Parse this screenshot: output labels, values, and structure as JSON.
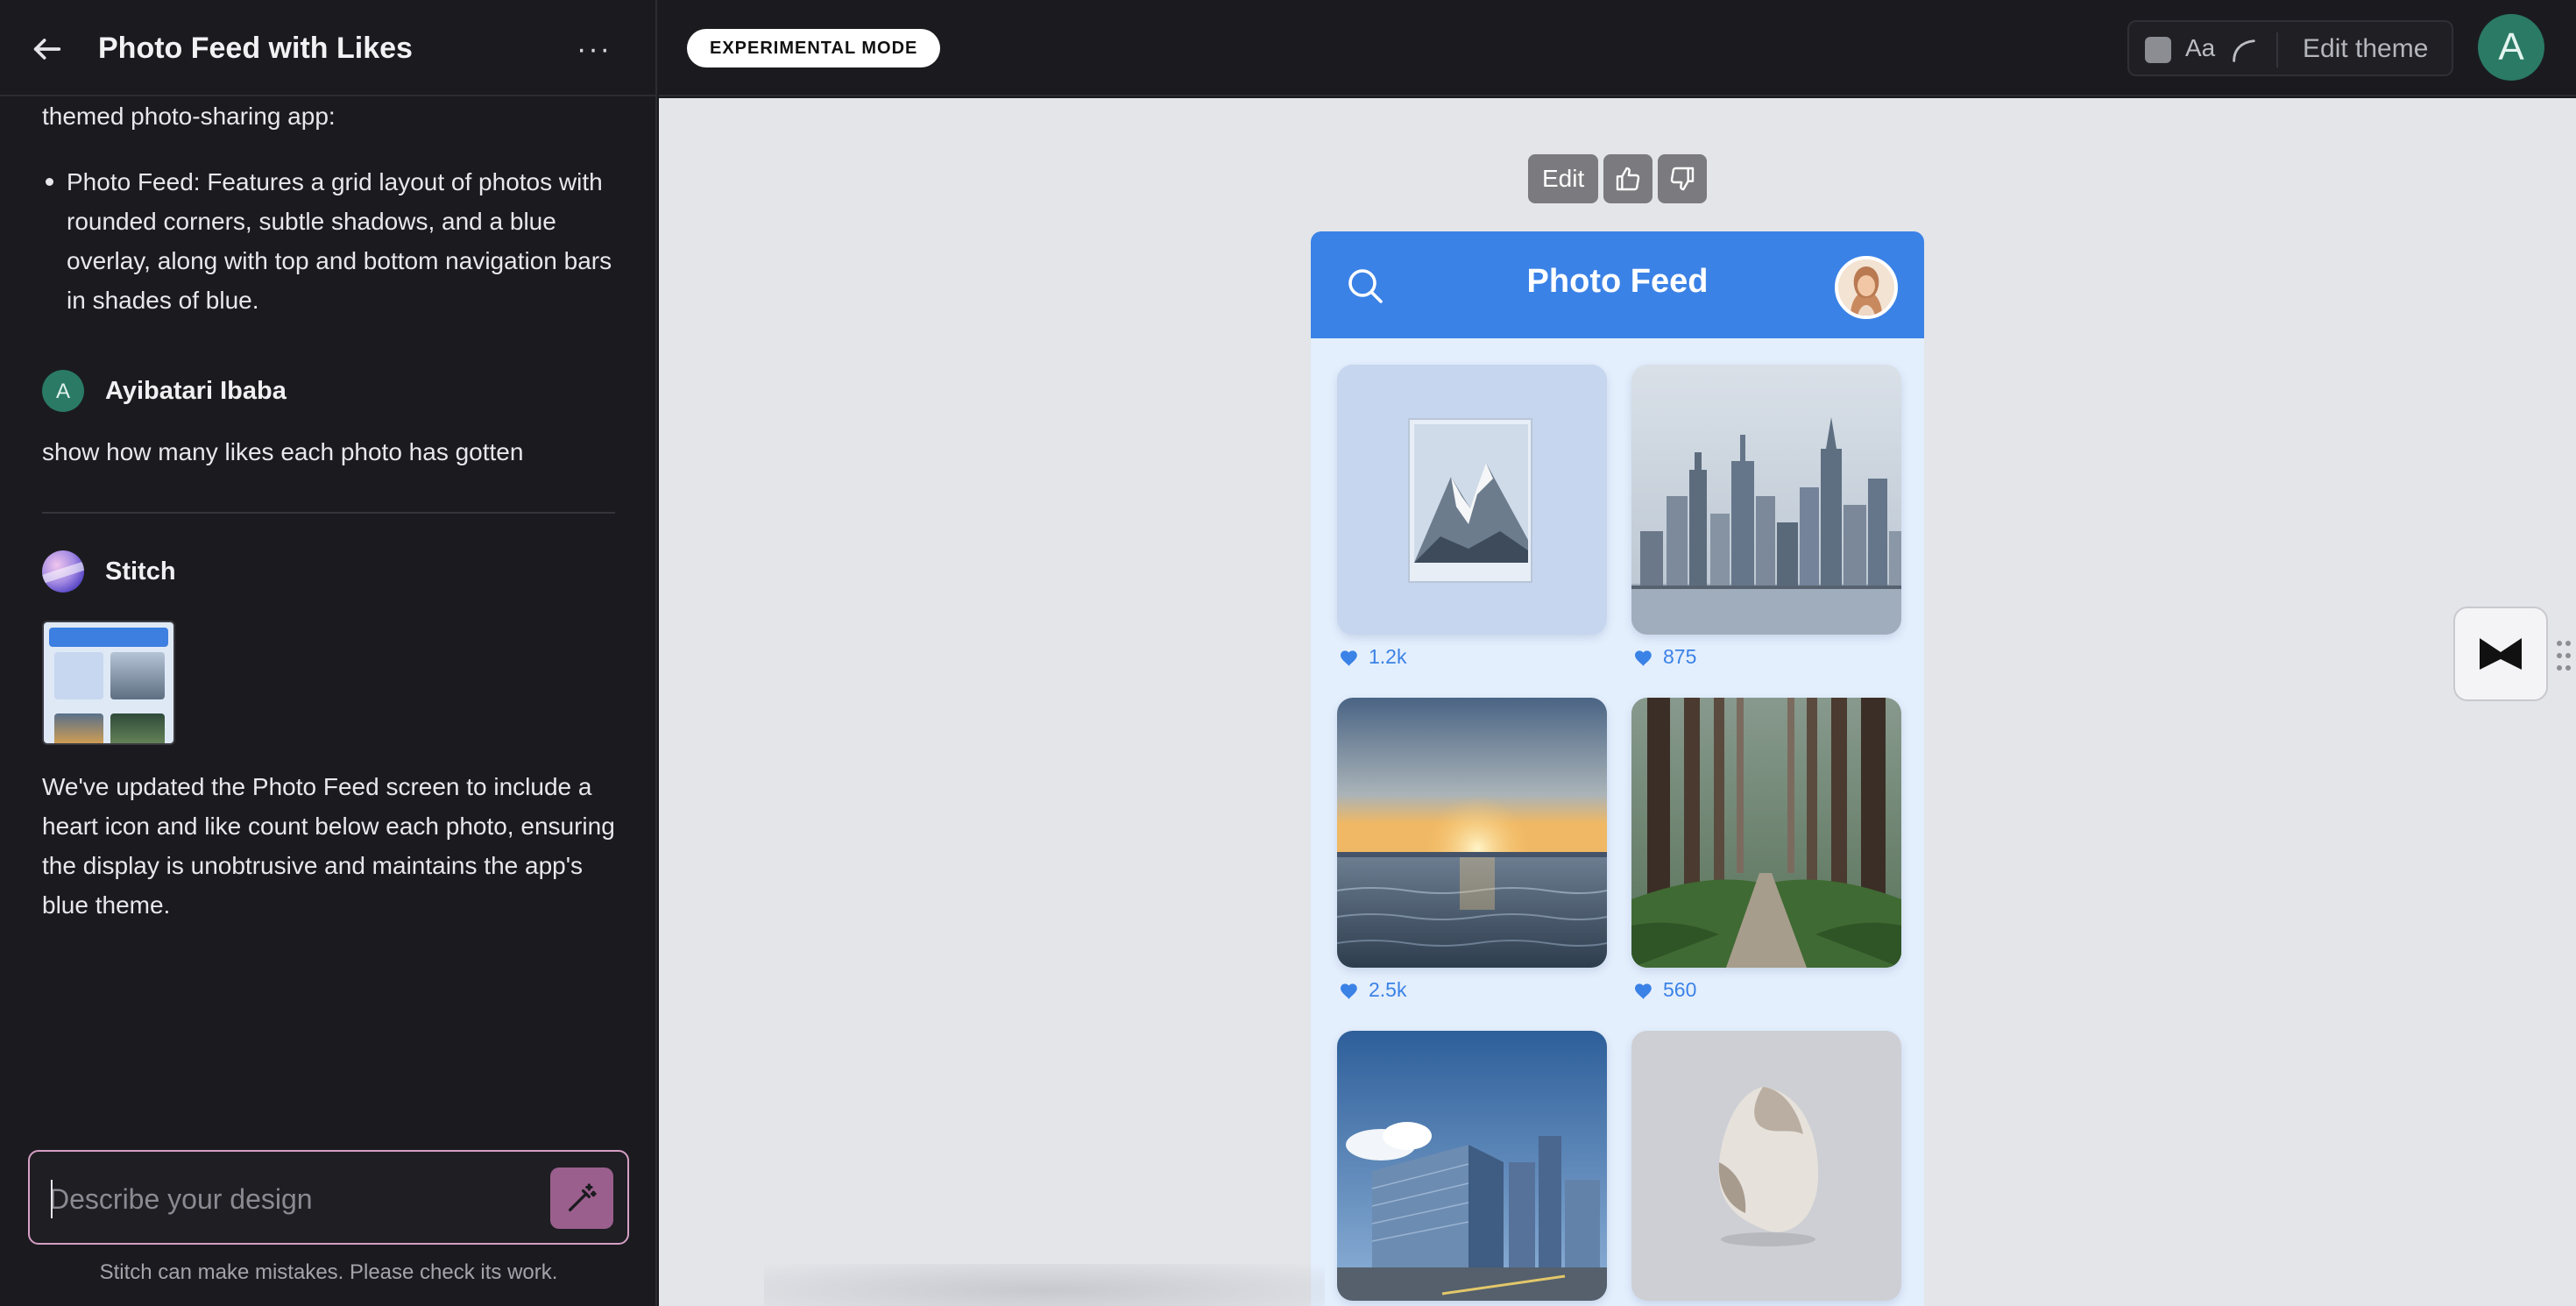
{
  "sidebar": {
    "title": "Photo Feed with Likes",
    "intro": "themed photo-sharing app:",
    "bullet": "Photo Feed: Features a grid layout of photos with rounded corners, subtle shadows, and a blue overlay, along with top and bottom navigation bars in shades of blue.",
    "user": {
      "initial": "A",
      "name": "Ayibatari Ibaba",
      "message": "show how many likes each photo has gotten"
    },
    "assistant": {
      "name": "Stitch",
      "message": "We've updated the Photo Feed screen to include a heart icon and like count below each photo, ensuring the display is unobtrusive and maintains the app's blue theme."
    },
    "composer": {
      "placeholder": "Describe your design"
    },
    "disclaimer": "Stitch can make mistakes. Please check its work."
  },
  "topbar": {
    "mode_badge": "EXPERIMENTAL MODE",
    "font_glyph": "Aa",
    "edit_theme": "Edit theme",
    "user_initial": "A"
  },
  "canvas": {
    "toolbar": {
      "edit_label": "Edit"
    },
    "phone": {
      "title": "Photo Feed",
      "photos": [
        {
          "subject": "mountain",
          "likes": "1.2k"
        },
        {
          "subject": "city-skyline",
          "likes": "875"
        },
        {
          "subject": "ocean-sunset",
          "likes": "2.5k"
        },
        {
          "subject": "forest-path",
          "likes": "560"
        },
        {
          "subject": "office-buildings",
          "likes": ""
        },
        {
          "subject": "stone-sculpture",
          "likes": ""
        }
      ]
    }
  },
  "colors": {
    "brand_blue": "#3b82e6",
    "accent_pink": "#d79fc6",
    "send_button": "#9a5f8d",
    "avatar_green": "#2a7a66"
  }
}
